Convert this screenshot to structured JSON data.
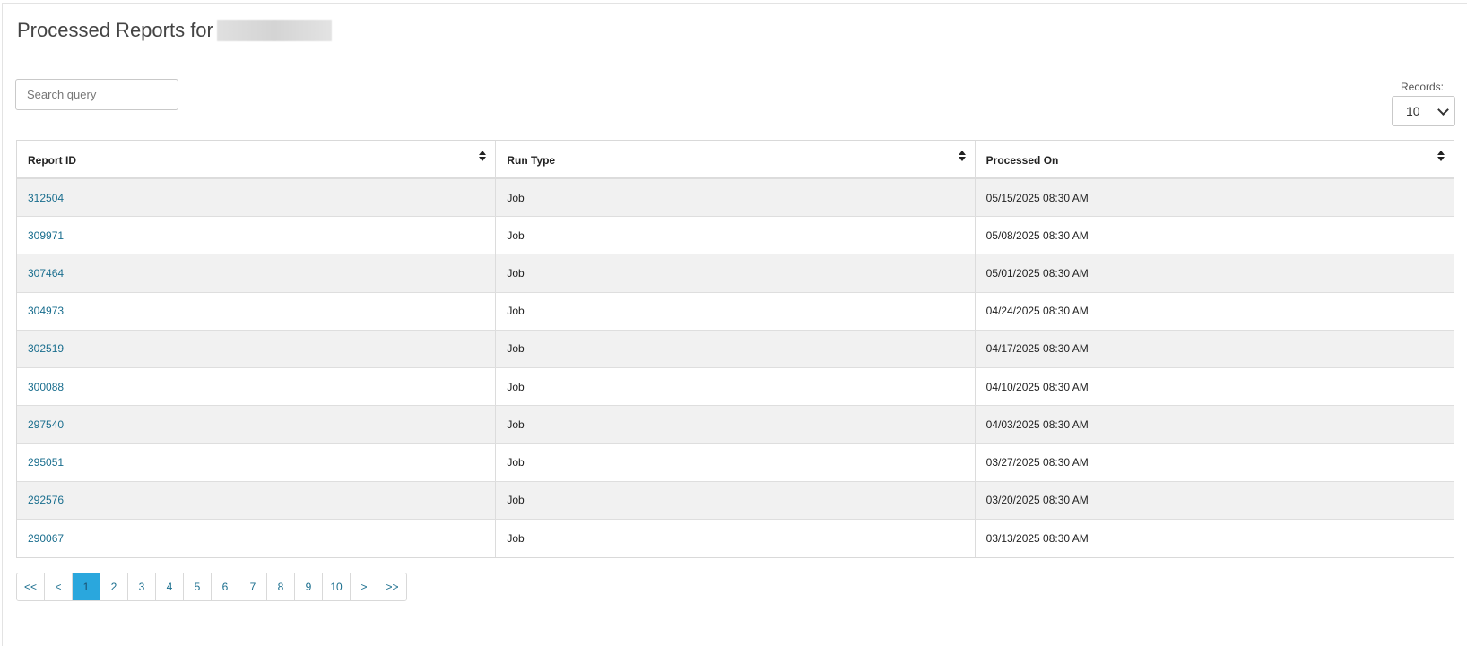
{
  "header": {
    "title": "Processed Reports for"
  },
  "search": {
    "placeholder": "Search query",
    "value": ""
  },
  "records": {
    "label": "Records:",
    "selected": "10"
  },
  "table": {
    "columns": [
      "Report ID",
      "Run Type",
      "Processed On"
    ],
    "rows": [
      {
        "report_id": "312504",
        "run_type": "Job",
        "processed_on": "05/15/2025 08:30 AM"
      },
      {
        "report_id": "309971",
        "run_type": "Job",
        "processed_on": "05/08/2025 08:30 AM"
      },
      {
        "report_id": "307464",
        "run_type": "Job",
        "processed_on": "05/01/2025 08:30 AM"
      },
      {
        "report_id": "304973",
        "run_type": "Job",
        "processed_on": "04/24/2025 08:30 AM"
      },
      {
        "report_id": "302519",
        "run_type": "Job",
        "processed_on": "04/17/2025 08:30 AM"
      },
      {
        "report_id": "300088",
        "run_type": "Job",
        "processed_on": "04/10/2025 08:30 AM"
      },
      {
        "report_id": "297540",
        "run_type": "Job",
        "processed_on": "04/03/2025 08:30 AM"
      },
      {
        "report_id": "295051",
        "run_type": "Job",
        "processed_on": "03/27/2025 08:30 AM"
      },
      {
        "report_id": "292576",
        "run_type": "Job",
        "processed_on": "03/20/2025 08:30 AM"
      },
      {
        "report_id": "290067",
        "run_type": "Job",
        "processed_on": "03/13/2025 08:30 AM"
      }
    ]
  },
  "pagination": {
    "first": "<<",
    "prev": "<",
    "pages": [
      "1",
      "2",
      "3",
      "4",
      "5",
      "6",
      "7",
      "8",
      "9",
      "10"
    ],
    "current": "1",
    "next": ">",
    "last": ">>"
  },
  "colors": {
    "link": "#1a6e8e",
    "active_page": "#2aa7dd",
    "row_stripe": "#f1f1f1"
  }
}
